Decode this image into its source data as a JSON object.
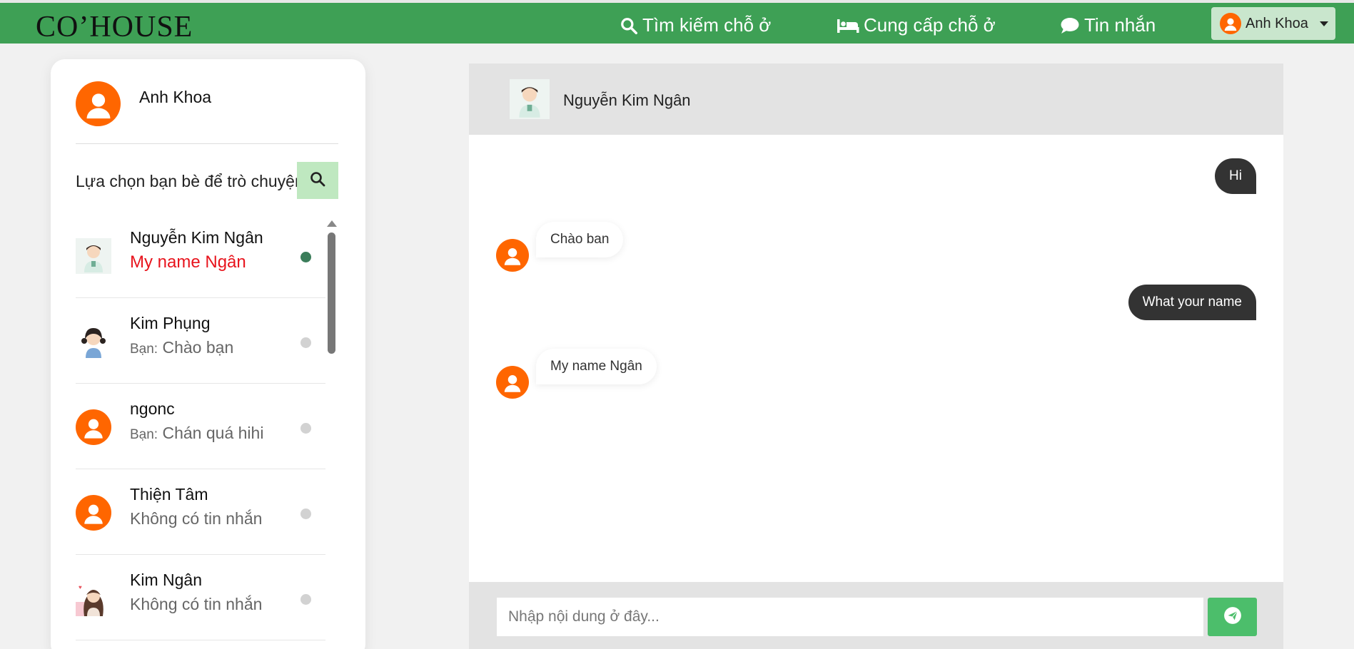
{
  "navbar": {
    "logo": "CO’HOUSE",
    "links": [
      {
        "label": "Tìm kiếm chỗ ở",
        "icon": "search-icon"
      },
      {
        "label": "Cung cấp chỗ ở",
        "icon": "bed-icon"
      },
      {
        "label": "Tin nhắn",
        "icon": "chat-bubble-icon"
      }
    ],
    "user": {
      "name": "Anh Khoa"
    }
  },
  "sidebar": {
    "me": {
      "name": "Anh Khoa"
    },
    "search_label": "Lựa chọn bạn bè để trò chuyện",
    "contacts": [
      {
        "name": "Nguyễn Kim Ngân",
        "prefix": "",
        "message": "My name Ngân",
        "online": true,
        "avatar": "boy-illustration"
      },
      {
        "name": "Kim Phụng",
        "prefix": "Bạn:",
        "message": "Chào bạn",
        "online": false,
        "avatar": "girl-illustration"
      },
      {
        "name": "ngonc",
        "prefix": "Bạn:",
        "message": "Chán quá hihi",
        "online": false,
        "avatar": "default-user"
      },
      {
        "name": "Thiện Tâm",
        "prefix": "",
        "message": "Không có tin nhắn",
        "online": false,
        "avatar": "default-user"
      },
      {
        "name": "Kim Ngân",
        "prefix": "",
        "message": "Không có tin nhắn",
        "online": false,
        "avatar": "girl-long-hair-illustration"
      }
    ]
  },
  "chat": {
    "partner_name": "Nguyễn Kim Ngân",
    "messages": [
      {
        "from": "me",
        "text": "Hi"
      },
      {
        "from": "them",
        "text": "Chào ban"
      },
      {
        "from": "me",
        "text": "What your name"
      },
      {
        "from": "them",
        "text": "My name Ngân"
      }
    ],
    "input_placeholder": "Nhập nội dung ở đây..."
  },
  "colors": {
    "navbar_green": "#3ea055",
    "accent_orange": "#ff6600",
    "online_dot": "#3b7d5a",
    "outgoing_bubble": "#333333",
    "send_button": "#4cbe6b"
  }
}
